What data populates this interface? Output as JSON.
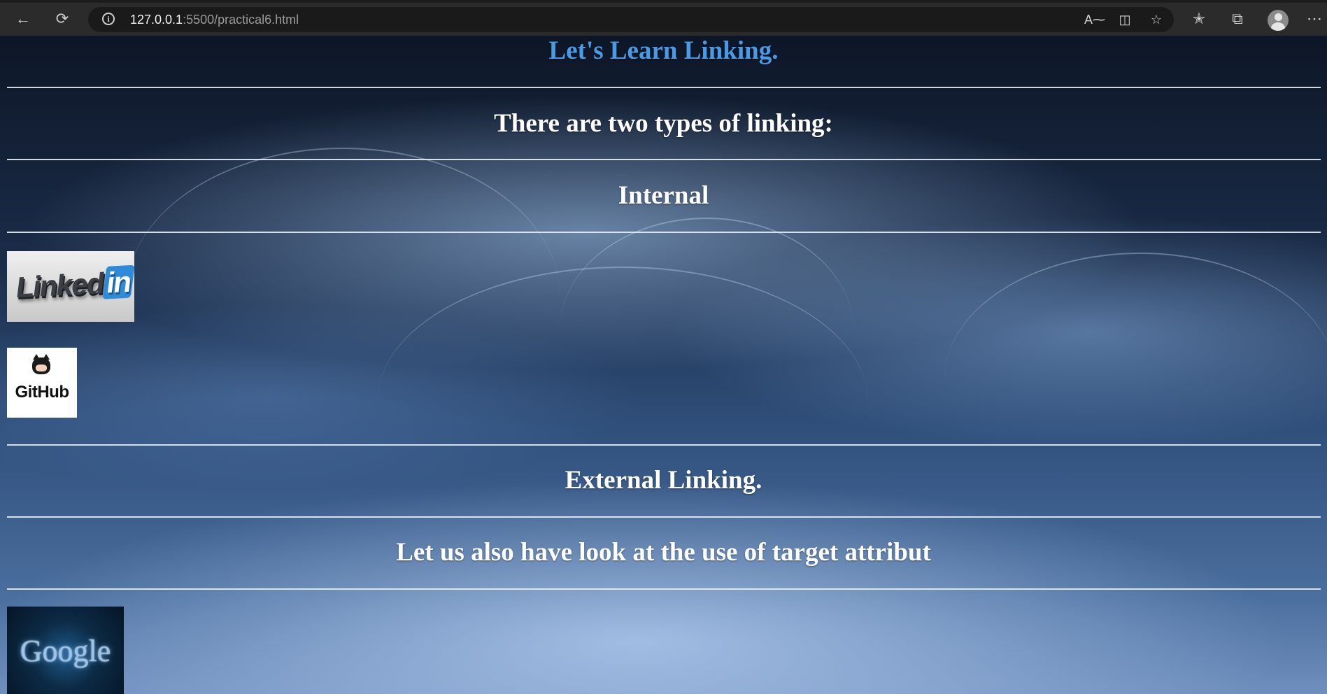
{
  "browser": {
    "url_host": "127.0.0.1",
    "url_rest": ":5500/practical6.html",
    "icons": [
      "back-arrow-icon",
      "refresh-icon",
      "info-icon",
      "read-aloud-icon",
      "immersive-reader-icon",
      "add-favorite-icon",
      "favorites-icon",
      "collections-icon",
      "profile-avatar-icon",
      "more-menu-icon"
    ]
  },
  "page": {
    "title": "Let's Learn Linking.",
    "title_color": "#4a9ae6",
    "heading_types": "There are two types of linking:",
    "heading_internal": "Internal",
    "heading_external": "External Linking.",
    "heading_target": "Let us also have look at the use of target attribut",
    "links": {
      "linkedin_text": "Linked",
      "linkedin_in": "in",
      "github_text": "GitHub",
      "google_text": "Google"
    }
  }
}
